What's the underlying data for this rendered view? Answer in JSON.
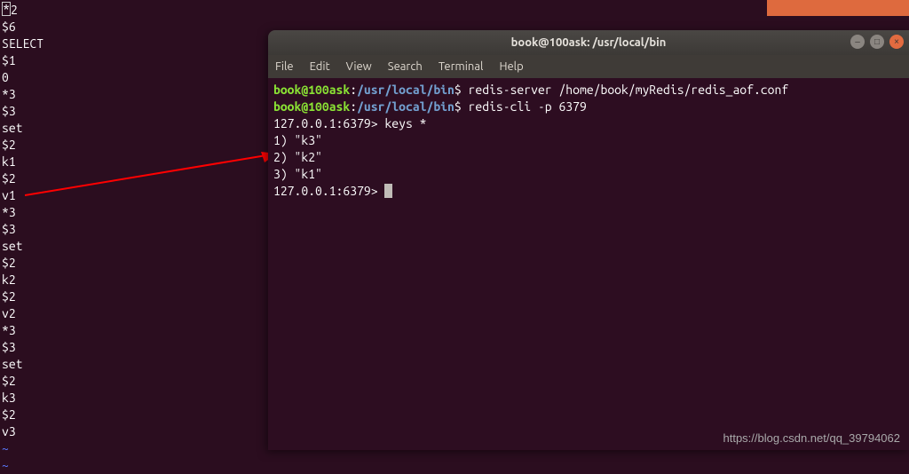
{
  "bg_terminal": {
    "first_char": "*",
    "lines_after_first": [
      "2",
      "$6",
      "SELECT",
      "$1",
      "0",
      "*3",
      "$3",
      "set",
      "$2",
      "k1",
      "$2",
      "v1",
      "*3",
      "$3",
      "set",
      "$2",
      "k2",
      "$2",
      "v2",
      "*3",
      "$3",
      "set",
      "$2",
      "k3",
      "$2",
      "v3"
    ],
    "tildes": [
      "~",
      "~"
    ]
  },
  "top_strip": {},
  "window": {
    "title": "book@100ask: /usr/local/bin",
    "menu": [
      "File",
      "Edit",
      "View",
      "Search",
      "Terminal",
      "Help"
    ],
    "prompt": {
      "user_host": "book@100ask",
      "colon": ":",
      "path": "/usr/local/bin",
      "dollar": "$"
    },
    "cmd1": " redis-server /home/book/myRedis/redis_aof.conf",
    "cmd2": " redis-cli -p 6379",
    "cli_prompt": "127.0.0.1:6379>",
    "cli_cmd": " keys *",
    "results": [
      "1) \"k3\"",
      "2) \"k2\"",
      "3) \"k1\""
    ],
    "controls": {
      "min": "–",
      "max": "□",
      "close": "×"
    }
  },
  "watermark": "https://blog.csdn.net/qq_39794062"
}
